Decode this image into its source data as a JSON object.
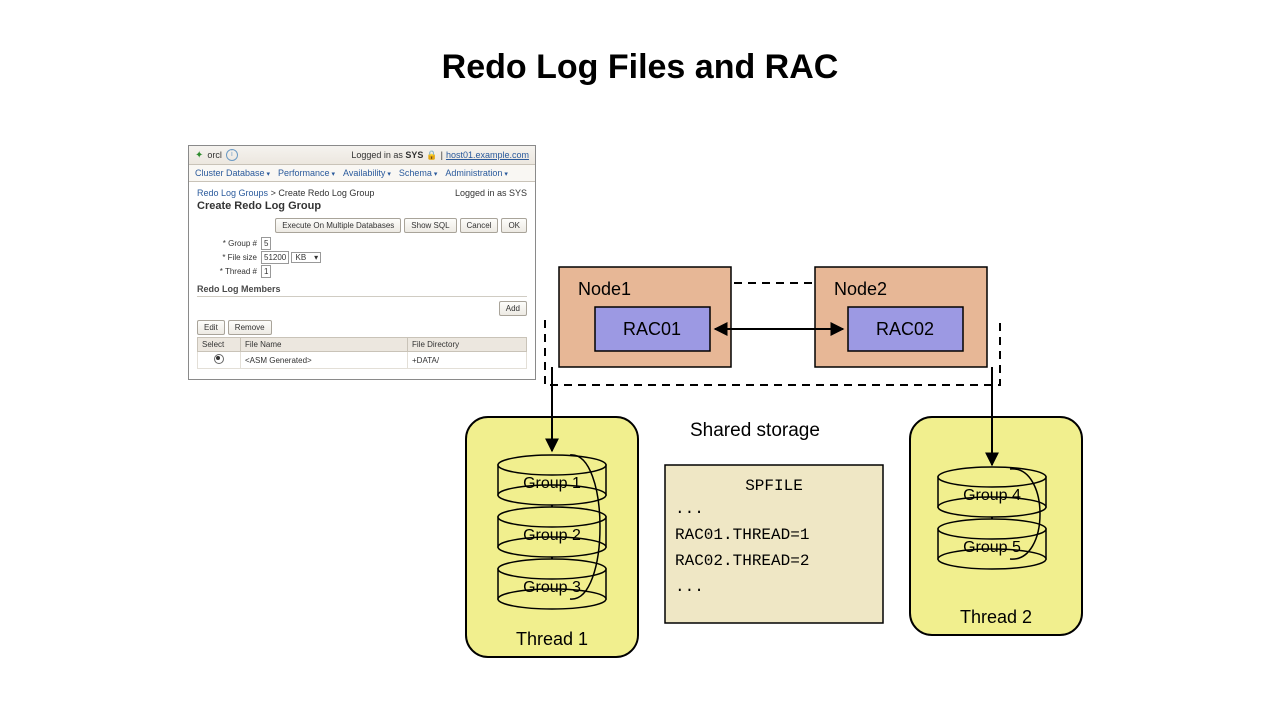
{
  "title": "Redo Log Files and RAC",
  "em": {
    "orcl": "orcl",
    "logged_prefix": "Logged in as ",
    "logged_user": "SYS",
    "host_link": "host01.example.com",
    "menus": [
      "Cluster Database",
      "Performance",
      "Availability",
      "Schema",
      "Administration"
    ],
    "breadcrumb_parent": "Redo Log Groups",
    "breadcrumb_sep": "  >  ",
    "breadcrumb_current": "Create Redo Log Group",
    "logged2": "Logged in as SYS",
    "page_title": "Create Redo Log Group",
    "btn_exec": "Execute On Multiple Databases",
    "btn_sql": "Show SQL",
    "btn_cancel": "Cancel",
    "btn_ok": "OK",
    "lbl_group": "Group #",
    "val_group": "5",
    "lbl_size": "File size",
    "val_size": "51200",
    "size_unit": "KB",
    "lbl_thread": "Thread #",
    "val_thread": "1",
    "section": "Redo Log Members",
    "btn_add": "Add",
    "btn_edit": "Edit",
    "btn_remove": "Remove",
    "col_select": "Select",
    "col_filename": "File Name",
    "col_filedir": "File Directory",
    "row_filename": "<ASM Generated>",
    "row_filedir": "+DATA/"
  },
  "diagram": {
    "node1": "Node1",
    "node2": "Node2",
    "rac1": "RAC01",
    "rac2": "RAC02",
    "shared": "Shared storage",
    "thread1_groups": [
      "Group 1",
      "Group 2",
      "Group 3"
    ],
    "thread2_groups": [
      "Group 4",
      "Group 5"
    ],
    "thread1_label": "Thread 1",
    "thread2_label": "Thread 2",
    "spfile_title": "SPFILE",
    "spfile_lines": [
      "...",
      "RAC01.THREAD=1",
      "RAC02.THREAD=2",
      "..."
    ]
  }
}
